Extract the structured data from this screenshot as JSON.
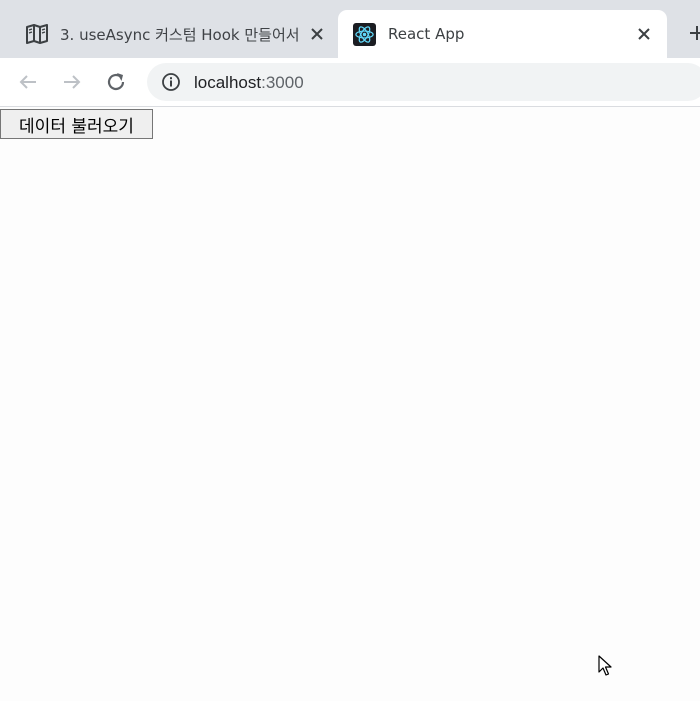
{
  "browser": {
    "tabs": [
      {
        "title": "3. useAsync 커스텀 Hook 만들어서",
        "favicon": "book-icon",
        "active": false
      },
      {
        "title": "React App",
        "favicon": "react-icon",
        "active": true
      }
    ],
    "new_tab_icon": "plus-icon",
    "address": {
      "host": "localhost",
      "port": ":3000"
    }
  },
  "page": {
    "load_button_label": "데이터 불러오기"
  },
  "colors": {
    "tabstrip": "#dee1e6",
    "omnibox": "#f1f3f4",
    "react_blue": "#61dafb"
  }
}
